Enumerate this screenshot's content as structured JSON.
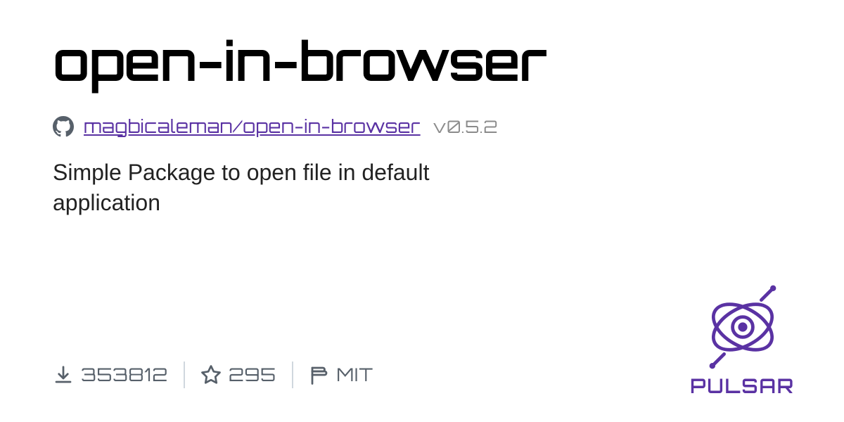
{
  "package": {
    "name": "open-in-browser",
    "repo": "magbicaleman/open-in-browser",
    "version": "v0.5.2",
    "description": "Simple Package to open file in default application"
  },
  "stats": {
    "downloads": "353812",
    "stargazers": "295",
    "license": "MIT"
  },
  "brand": {
    "name": "PULSAR"
  }
}
